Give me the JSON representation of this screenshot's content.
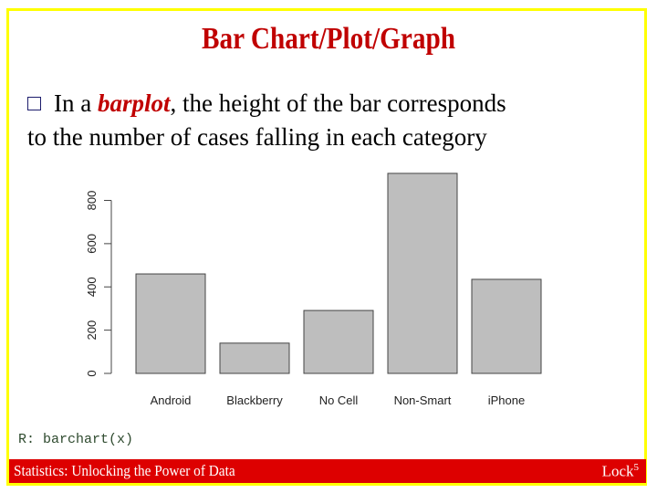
{
  "slide": {
    "title": "Bar Chart/Plot/Graph",
    "bullet": {
      "prefix": "In a ",
      "emphasis": "barplot",
      "suffix_line1": ", the height of the bar corresponds",
      "line2": "to the number of cases falling in each category"
    },
    "code": "R: barchart(x)",
    "footer": {
      "left": "Statistics: Unlocking the Power of Data",
      "right_main": "Lock",
      "right_sup": "5"
    },
    "colors": {
      "title": "#c00000",
      "frame": "#ffff00",
      "footer_bg": "#dd0000",
      "bar_fill": "#bebebe",
      "bar_stroke": "#444444"
    }
  },
  "chart_data": {
    "type": "bar",
    "title": "",
    "xlabel": "",
    "ylabel": "",
    "categories": [
      "Android",
      "Blackberry",
      "No Cell",
      "Non-Smart",
      "iPhone"
    ],
    "values": [
      460,
      140,
      291,
      925,
      435
    ],
    "ylim": [
      0,
      800
    ],
    "yticks": [
      0,
      200,
      400,
      600,
      800
    ],
    "ytick_labels": [
      "0",
      "200",
      "400",
      "600",
      "800"
    ],
    "grid": false,
    "legend": "none"
  }
}
